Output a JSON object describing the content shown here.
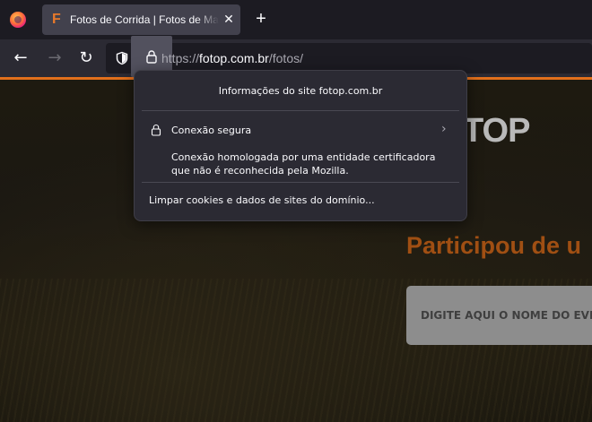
{
  "tab": {
    "title": "Fotos de Corrida | Fotos de Maratonas",
    "favicon_letter": "F",
    "close_glyph": "✕"
  },
  "new_tab_glyph": "+",
  "nav": {
    "back_glyph": "←",
    "forward_glyph": "→",
    "reload_glyph": "↻"
  },
  "urlbar": {
    "scheme": "https://",
    "host": "fotop.com.br",
    "path": "/fotos/"
  },
  "page": {
    "logo_text": "TOP",
    "headline": "Participou de u",
    "search_placeholder": "DIGITE AQUI O NOME DO EVENTO"
  },
  "popup": {
    "title": "Informações do site fotop.com.br",
    "connection_label": "Conexão segura",
    "connection_desc_line1": "Conexão homologada por uma entidade certificadora",
    "connection_desc_line2": "que não é reconhecida pela Mozilla.",
    "clear_cookies_label": "Limpar cookies e dados de sites do domínio..."
  },
  "colors": {
    "accent": "#e16f1c",
    "headline": "#a04f13",
    "popup_bg": "#2b2a33"
  }
}
